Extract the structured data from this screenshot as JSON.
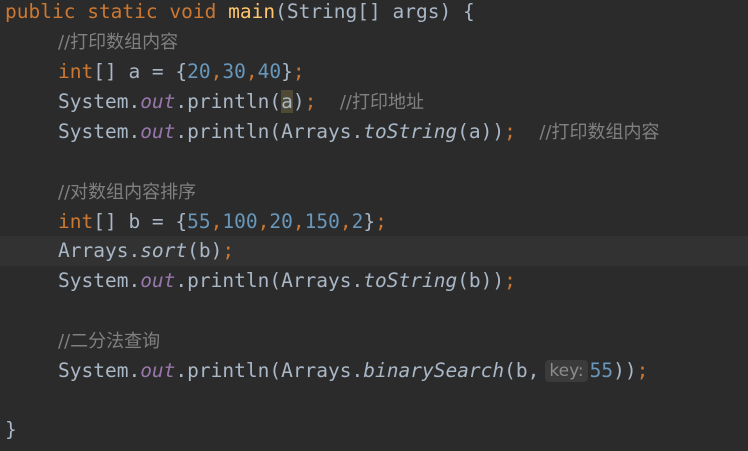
{
  "lines": {
    "l0": {
      "public": "public",
      "static": "static",
      "void": "void",
      "main": "main",
      "sig_open": "(String[] args) ",
      "brace": "{"
    },
    "l1": {
      "comment": "//打印数组内容"
    },
    "l2": {
      "int": "int",
      "decl": "[] a = {",
      "n1": "20",
      "c1": ",",
      "n2": "30",
      "c2": ",",
      "n3": "40",
      "close": "}",
      "semi": ";"
    },
    "l3": {
      "system": "System.",
      "out": "out",
      "println_open": ".println(",
      "arg": "a",
      "close": ")",
      "semi": ";",
      "gap": "  ",
      "comment": "//打印地址"
    },
    "l4": {
      "system": "System.",
      "out": "out",
      "println_open": ".println(Arrays.",
      "method": "toString",
      "args": "(a))",
      "semi": ";",
      "gap": "  ",
      "comment": "//打印数组内容"
    },
    "l6": {
      "comment": "//对数组内容排序"
    },
    "l7": {
      "int": "int",
      "decl": "[] b = {",
      "n1": "55",
      "c1": ",",
      "n2": "100",
      "c2": ",",
      "n3": "20",
      "c3": ",",
      "n4": "150",
      "c4": ",",
      "n5": "2",
      "close": "}",
      "semi": ";"
    },
    "l8": {
      "arrays": "Arrays.",
      "method": "sort",
      "args": "(b)",
      "semi": ";"
    },
    "l9": {
      "system": "System.",
      "out": "out",
      "println_open": ".println(Arrays.",
      "method": "toString",
      "args": "(b))",
      "semi": ";"
    },
    "l11": {
      "comment": "//二分法查询"
    },
    "l12": {
      "system": "System.",
      "out": "out",
      "println_open": ".println(Arrays.",
      "method": "binarySearch",
      "args_open": "(b,",
      "hint": "key:",
      "value": "55",
      "args_close": "))",
      "semi": ";"
    },
    "l14": {
      "brace": "}"
    }
  }
}
